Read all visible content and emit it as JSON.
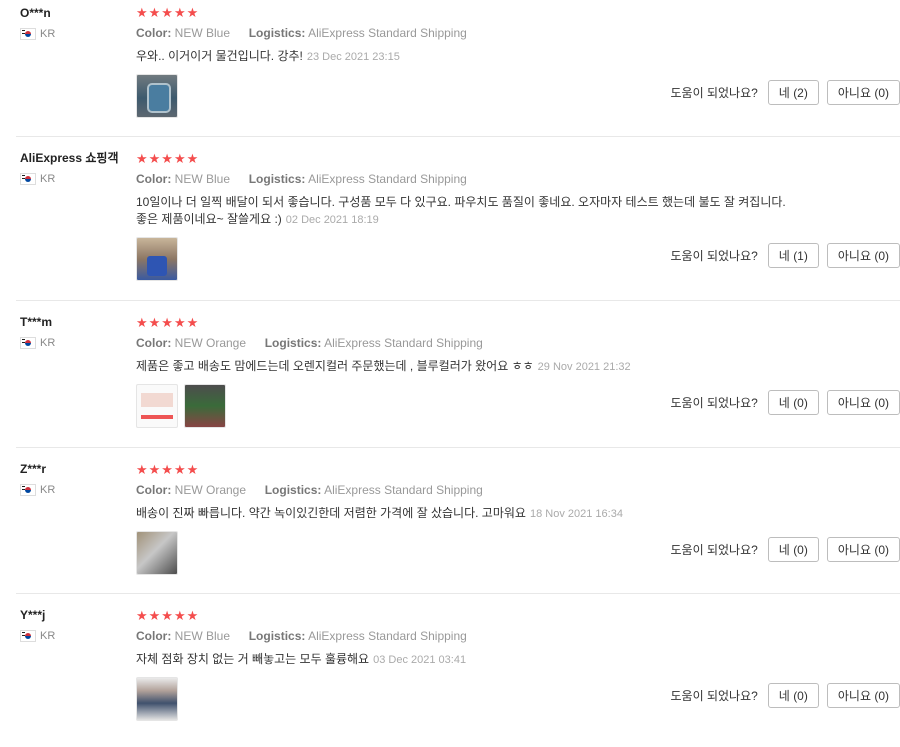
{
  "labels": {
    "color": "Color:",
    "logistics": "Logistics:",
    "helpful_question": "도움이 되었나요?",
    "yes": "네",
    "no": "아니요"
  },
  "stars_text": "★★★★★",
  "reviews": [
    {
      "user": "O***n",
      "country": "KR",
      "rating": 5,
      "color": "NEW Blue",
      "logistics": "AliExpress Standard Shipping",
      "text": "우와.. 이거이거 물건입니다. 강추!",
      "date": "23 Dec 2021 23:15",
      "photos": [
        "stove-photo"
      ],
      "yes": "(2)",
      "no": "(0)"
    },
    {
      "user": "AliExpress 쇼핑객",
      "country": "KR",
      "rating": 5,
      "color": "NEW Blue",
      "logistics": "AliExpress Standard Shipping",
      "text": "10일이나 더 일찍 배달이 되서 좋습니다. 구성품 모두 다 있구요. 파우치도 품질이 좋네요. 오자마자 테스트 했는데 불도 잘 켜집니다. 좋은 제품이네요~ 잘쓸게요 :)",
      "date": "02 Dec 2021 18:19",
      "photos": [
        "stove-photo"
      ],
      "yes": "(1)",
      "no": "(0)"
    },
    {
      "user": "T***m",
      "country": "KR",
      "rating": 5,
      "color": "NEW Orange",
      "logistics": "AliExpress Standard Shipping",
      "text": "제품은 좋고 배송도 맘에드는데 오렌지컬러 주문했는데 , 블루컬러가 왔어요 ㅎㅎ",
      "date": "29 Nov 2021 21:32",
      "photos": [
        "order-screenshot",
        "stove-photo"
      ],
      "yes": "(0)",
      "no": "(0)"
    },
    {
      "user": "Z***r",
      "country": "KR",
      "rating": 5,
      "color": "NEW Orange",
      "logistics": "AliExpress Standard Shipping",
      "text": "배송이 진짜 빠릅니다. 약간 녹이있긴한데 저렴한 가격에 잘 샀습니다. 고마워요",
      "date": "18 Nov 2021 16:34",
      "photos": [
        "stove-photo"
      ],
      "yes": "(0)",
      "no": "(0)"
    },
    {
      "user": "Y***j",
      "country": "KR",
      "rating": 5,
      "color": "NEW Blue",
      "logistics": "AliExpress Standard Shipping",
      "text": "자체 점화 장치 없는 거 빼놓고는 모두 훌륭해요",
      "date": "03 Dec 2021 03:41",
      "photos": [
        "stove-photo"
      ],
      "yes": "(0)",
      "no": "(0)"
    }
  ]
}
